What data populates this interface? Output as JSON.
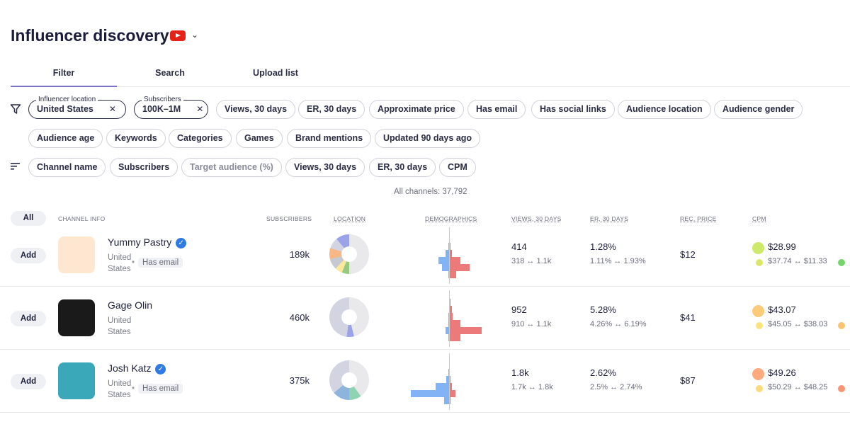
{
  "header": {
    "title": "Influencer discovery",
    "platform_icon": "youtube-icon"
  },
  "tabs": [
    {
      "label": "Filter",
      "active": true
    },
    {
      "label": "Search"
    },
    {
      "label": "Upload list"
    }
  ],
  "filters": {
    "selected": [
      {
        "label": "Influencer location",
        "value": "United States"
      },
      {
        "label": "Subscribers",
        "value": "100K–1M"
      }
    ],
    "chips": [
      "Views, 30 days",
      "ER, 30 days",
      "Approximate price",
      "Has email",
      "Has social links",
      "Audience location",
      "Audience gender",
      "Audience age",
      "Keywords",
      "Categories",
      "Games",
      "Brand mentions",
      "Updated 90 days ago"
    ]
  },
  "sort": {
    "chips": [
      "Channel name",
      "Subscribers",
      "Target audience (%)",
      "Views, 30 days",
      "ER, 30 days",
      "CPM"
    ],
    "disabled": "Target audience (%)"
  },
  "total": "All channels: 37,792",
  "table": {
    "all_label": "All",
    "headers": [
      "CHANNEL INFO",
      "SUBSCRIBERS",
      "LOCATION",
      "DEMOGRAPHICS",
      "VIEWS, 30 DAYS",
      "ER, 30 DAYS",
      "REC. PRICE",
      "CPM"
    ],
    "add_label": "Add",
    "has_email_label": "Has email",
    "rows": [
      {
        "name": "Yummy Pastry",
        "verified": true,
        "location": "United States",
        "has_email": true,
        "subscribers": "189k",
        "views": "414",
        "views_range": "318 ↔ 1.1k",
        "er": "1.28%",
        "er_range": "1.11% ↔ 1.93%",
        "price": "$12",
        "cpm": "$28.99",
        "cpm_range": "$37.74 ↔ $11.33",
        "cpm_color": "#cde86a",
        "cpm_low_color": "#dde86a",
        "cpm_high_color": "#74d66a",
        "location_share": [
          {
            "color": "#e9e9ec",
            "pct": 50
          },
          {
            "color": "#97c97f",
            "pct": 6
          },
          {
            "color": "#fbe89a",
            "pct": 6
          },
          {
            "color": "#c8c8d2",
            "pct": 9
          },
          {
            "color": "#f8b785",
            "pct": 9
          },
          {
            "color": "#d2d4e2",
            "pct": 9
          },
          {
            "color": "#9aa3e8",
            "pct": 11
          }
        ],
        "demographics": {
          "male": [
            0,
            1,
            4,
            12,
            8,
            1
          ],
          "female": [
            0,
            1,
            2,
            12,
            22,
            7
          ]
        },
        "avatar_color": "#fde7d0"
      },
      {
        "name": "Gage Olin",
        "verified": false,
        "location": "United States",
        "has_email": false,
        "subscribers": "460k",
        "views": "952",
        "views_range": "910 ↔ 1.1k",
        "er": "5.28%",
        "er_range": "4.26% ↔ 6.19%",
        "price": "$41",
        "cpm": "$43.07",
        "cpm_range": "$45.05 ↔ $38.03",
        "cpm_color": "#fccb7a",
        "cpm_low_color": "#fde37a",
        "cpm_high_color": "#fcc46e",
        "location_share": [
          {
            "color": "#e9e9ec",
            "pct": 46
          },
          {
            "color": "#9aa3e8",
            "pct": 6
          },
          {
            "color": "#d2d4e2",
            "pct": 48
          }
        ],
        "demographics": {
          "male": [
            0,
            0,
            1,
            1,
            4,
            1
          ],
          "female": [
            1,
            2,
            3,
            12,
            36,
            12
          ]
        },
        "avatar_color": "#1a1a1a"
      },
      {
        "name": "Josh Katz",
        "verified": true,
        "location": "United States",
        "has_email": true,
        "subscribers": "375k",
        "views": "1.8k",
        "views_range": "1.7k ↔ 1.8k",
        "er": "2.62%",
        "er_range": "2.5% ↔ 2.74%",
        "price": "$87",
        "cpm": "$49.26",
        "cpm_range": "$50.29 ↔ $48.25",
        "cpm_color": "#fbab7e",
        "cpm_low_color": "#fdd97a",
        "cpm_high_color": "#f99475",
        "location_share": [
          {
            "color": "#e9e9ec",
            "pct": 40
          },
          {
            "color": "#8fd3b3",
            "pct": 10
          },
          {
            "color": "#8cb4dc",
            "pct": 14
          },
          {
            "color": "#d2d4e2",
            "pct": 36
          }
        ],
        "demographics": {
          "male": [
            0,
            1,
            3,
            15,
            43,
            6
          ],
          "female": [
            0,
            0,
            1,
            2,
            6,
            1
          ]
        },
        "avatar_color": "#3aa8b8"
      }
    ]
  }
}
